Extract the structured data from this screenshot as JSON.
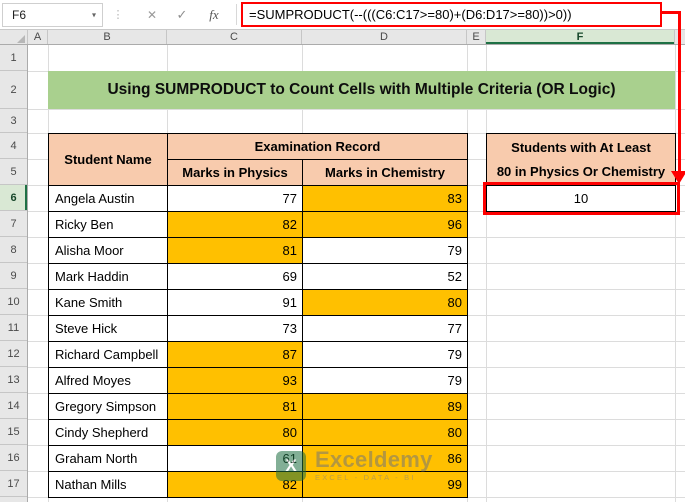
{
  "window": {
    "name_box_value": "F6",
    "formula": "=SUMPRODUCT(--(((C6:C17>=80)+(D6:D17>=80))>0))"
  },
  "icons": {
    "name_box_dropdown": "▾",
    "grip_dots": "⋮",
    "cancel": "✕",
    "enter": "✓",
    "function": "fx"
  },
  "sheet": {
    "column_headers": [
      "A",
      "B",
      "C",
      "D",
      "E",
      "F"
    ],
    "row_headers": [
      1,
      2,
      3,
      4,
      5,
      6,
      7,
      8,
      9,
      10,
      11,
      12,
      13,
      14,
      15,
      16,
      17
    ],
    "selected_column": "F",
    "selected_row": 6,
    "title": "Using SUMPRODUCT to Count Cells with Multiple Criteria (OR Logic)",
    "table": {
      "headers": {
        "student": "Student Name",
        "exam": "Examination Record",
        "physics": "Marks in Physics",
        "chemistry": "Marks in Chemistry"
      },
      "students": [
        {
          "name": "Angela Austin",
          "physics": 77,
          "chemistry": 83,
          "physics_highlight": false,
          "chemistry_highlight": true
        },
        {
          "name": "Ricky Ben",
          "physics": 82,
          "chemistry": 96,
          "physics_highlight": true,
          "chemistry_highlight": true
        },
        {
          "name": "Alisha Moor",
          "physics": 81,
          "chemistry": 79,
          "physics_highlight": true,
          "chemistry_highlight": false
        },
        {
          "name": "Mark Haddin",
          "physics": 69,
          "chemistry": 52,
          "physics_highlight": false,
          "chemistry_highlight": false
        },
        {
          "name": "Kane Smith",
          "physics": 91,
          "chemistry": 80,
          "physics_highlight": false,
          "chemistry_highlight": true
        },
        {
          "name": "Steve Hick",
          "physics": 73,
          "chemistry": 77,
          "physics_highlight": false,
          "chemistry_highlight": false
        },
        {
          "name": "Richard Campbell",
          "physics": 87,
          "chemistry": 79,
          "physics_highlight": true,
          "chemistry_highlight": false
        },
        {
          "name": "Alfred Moyes",
          "physics": 93,
          "chemistry": 79,
          "physics_highlight": true,
          "chemistry_highlight": false
        },
        {
          "name": "Gregory Simpson",
          "physics": 81,
          "chemistry": 89,
          "physics_highlight": true,
          "chemistry_highlight": true
        },
        {
          "name": "Cindy Shepherd",
          "physics": 80,
          "chemistry": 80,
          "physics_highlight": true,
          "chemistry_highlight": true
        },
        {
          "name": "Graham North",
          "physics": 61,
          "chemistry": 86,
          "physics_highlight": false,
          "chemistry_highlight": true
        },
        {
          "name": "Nathan Mills",
          "physics": 82,
          "chemistry": 99,
          "physics_highlight": true,
          "chemistry_highlight": true
        }
      ]
    },
    "result": {
      "label_line1": "Students with At Least",
      "label_line2": "80 in Physics Or Chemistry",
      "value": "10"
    }
  },
  "watermark": {
    "logo_letter": "X",
    "brand": "Exceldemy",
    "tagline": "EXCEL - DATA - BI"
  },
  "colors": {
    "title_bg": "#A9D08E",
    "table_header_bg": "#F8CBAD",
    "highlight_bg": "#FFC000",
    "annotation_red": "#FE0000",
    "selection_green": "#1E7145"
  }
}
